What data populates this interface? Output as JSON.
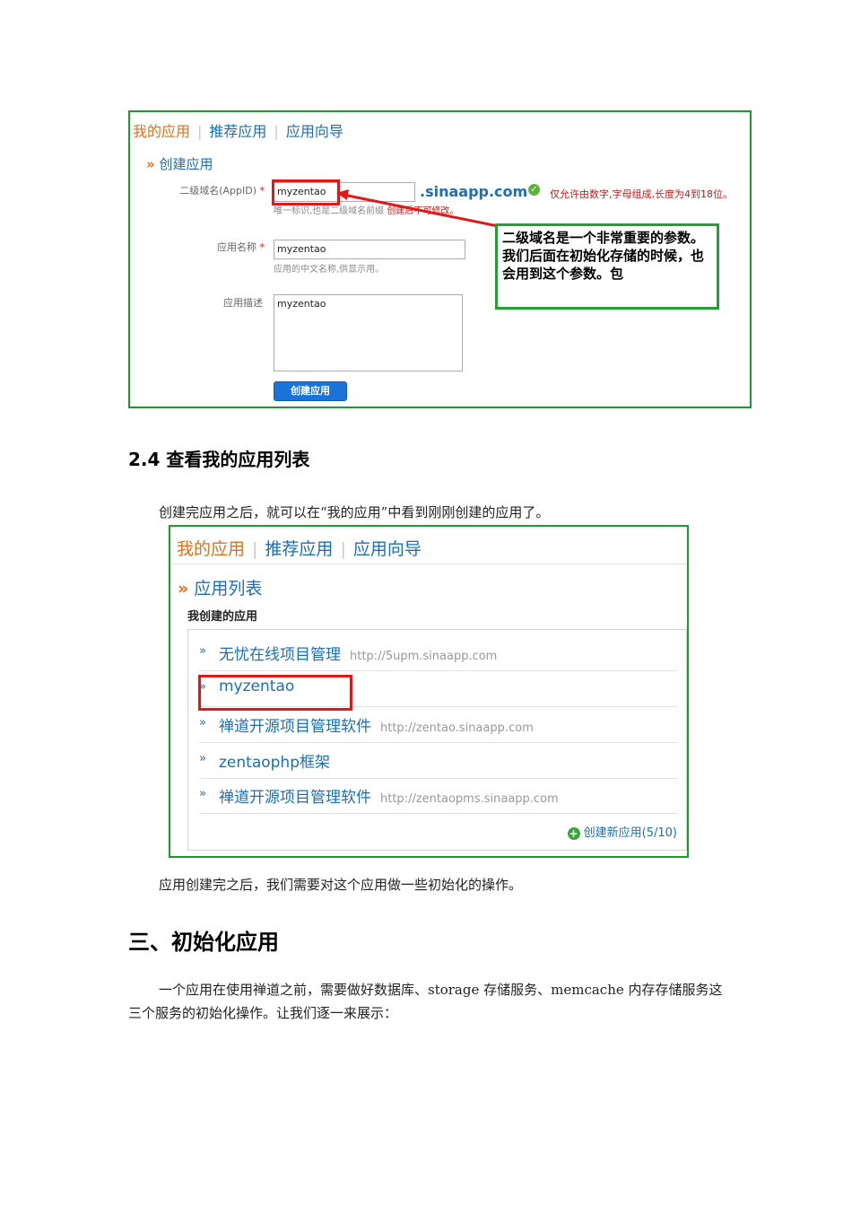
{
  "figure1": {
    "tabs": [
      "我的应用",
      "推荐应用",
      "应用向导"
    ],
    "section_title": "创建应用",
    "appid_label": "二级域名(AppID)",
    "appid_value": "myzentao",
    "domain_suffix": ".sinaapp.com",
    "appid_rule": "仅允许由数字,字母组成,长度为4到18位。",
    "appid_hint": "唯一标识,也是二级域名前缀",
    "appid_hint_red": "创建后不可修改。",
    "appname_label": "应用名称",
    "appname_value": "myzentao",
    "appname_hint": "应用的中文名称,供显示用。",
    "desc_label": "应用描述",
    "desc_value": "myzentao",
    "required_mark": "*",
    "create_button": "创建应用",
    "callout_text": "二级域名是一个非常重要的参数。我们后面在初始化存储的时候，也会用到这个参数。包"
  },
  "heading_24": "2.4 查看我的应用列表",
  "para1": "创建完应用之后，就可以在“我的应用”中看到刚刚创建的应用了。",
  "figure2": {
    "tabs": [
      "我的应用",
      "推荐应用",
      "应用向导"
    ],
    "section_title": "应用列表",
    "subheading": "我创建的应用",
    "apps": [
      {
        "name": "无忧在线项目管理",
        "url": "http://5upm.sinaapp.com"
      },
      {
        "name": "myzentao",
        "url": ""
      },
      {
        "name": "禅道开源项目管理软件",
        "url": "http://zentao.sinaapp.com"
      },
      {
        "name": "zentaophp框架",
        "url": ""
      },
      {
        "name": "禅道开源项目管理软件",
        "url": "http://zentaopms.sinaapp.com"
      }
    ],
    "new_app_link": "创建新应用(5/10)"
  },
  "para2": "应用创建完之后，我们需要对这个应用做一些初始化的操作。",
  "heading_3": "三、初始化应用",
  "para3": "一个应用在使用禅道之前，需要做好数据库、storage 存储服务、memcache 内存存储服务这三个服务的初始化操作。让我们逐一来展示：",
  "colors": {
    "frame_green": "#1e9a2c",
    "highlight_red": "#e01818",
    "link_blue": "#1a6fb8",
    "tab_orange": "#e0701a"
  }
}
